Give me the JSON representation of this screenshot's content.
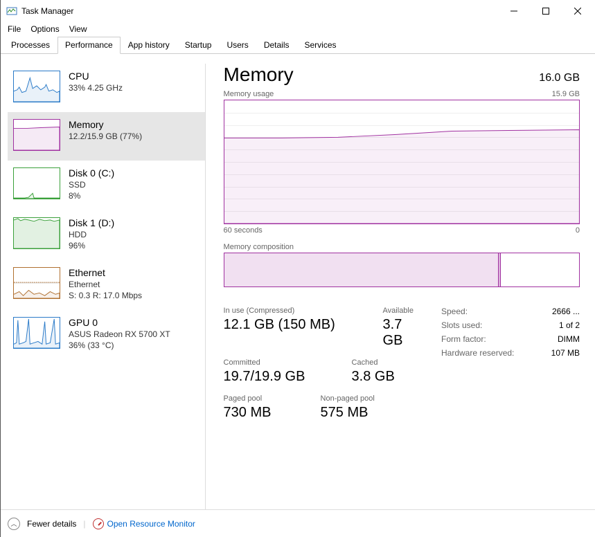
{
  "window": {
    "title": "Task Manager"
  },
  "menu": {
    "file": "File",
    "options": "Options",
    "view": "View"
  },
  "tabs": [
    "Processes",
    "Performance",
    "App history",
    "Startup",
    "Users",
    "Details",
    "Services"
  ],
  "active_tab": 1,
  "sidebar": [
    {
      "title": "CPU",
      "sub1": "33%  4.25 GHz",
      "sub2": "",
      "color": "cpu"
    },
    {
      "title": "Memory",
      "sub1": "12.2/15.9 GB (77%)",
      "sub2": "",
      "color": "mem",
      "selected": true
    },
    {
      "title": "Disk 0 (C:)",
      "sub1": "SSD",
      "sub2": "8%",
      "color": "disk0"
    },
    {
      "title": "Disk 1 (D:)",
      "sub1": "HDD",
      "sub2": "96%",
      "color": "disk1"
    },
    {
      "title": "Ethernet",
      "sub1": "Ethernet",
      "sub2": "S: 0.3  R: 17.0 Mbps",
      "color": "eth"
    },
    {
      "title": "GPU 0",
      "sub1": "ASUS Radeon RX 5700 XT",
      "sub2": "36%  (33 °C)",
      "color": "gpu"
    }
  ],
  "main": {
    "title": "Memory",
    "total": "16.0 GB",
    "usage_label": "Memory usage",
    "usage_max": "15.9 GB",
    "axis_left": "60 seconds",
    "axis_right": "0",
    "comp_label": "Memory composition",
    "stats": {
      "inuse_label": "In use (Compressed)",
      "inuse_value": "12.1 GB (150 MB)",
      "available_label": "Available",
      "available_value": "3.7 GB",
      "committed_label": "Committed",
      "committed_value": "19.7/19.9 GB",
      "cached_label": "Cached",
      "cached_value": "3.8 GB",
      "paged_label": "Paged pool",
      "paged_value": "730 MB",
      "nonpaged_label": "Non-paged pool",
      "nonpaged_value": "575 MB"
    },
    "specs": {
      "speed_label": "Speed:",
      "speed_value": "2666 ...",
      "slots_label": "Slots used:",
      "slots_value": "1 of 2",
      "form_label": "Form factor:",
      "form_value": "DIMM",
      "reserved_label": "Hardware reserved:",
      "reserved_value": "107 MB"
    }
  },
  "footer": {
    "fewer": "Fewer details",
    "resmon": "Open Resource Monitor"
  }
}
